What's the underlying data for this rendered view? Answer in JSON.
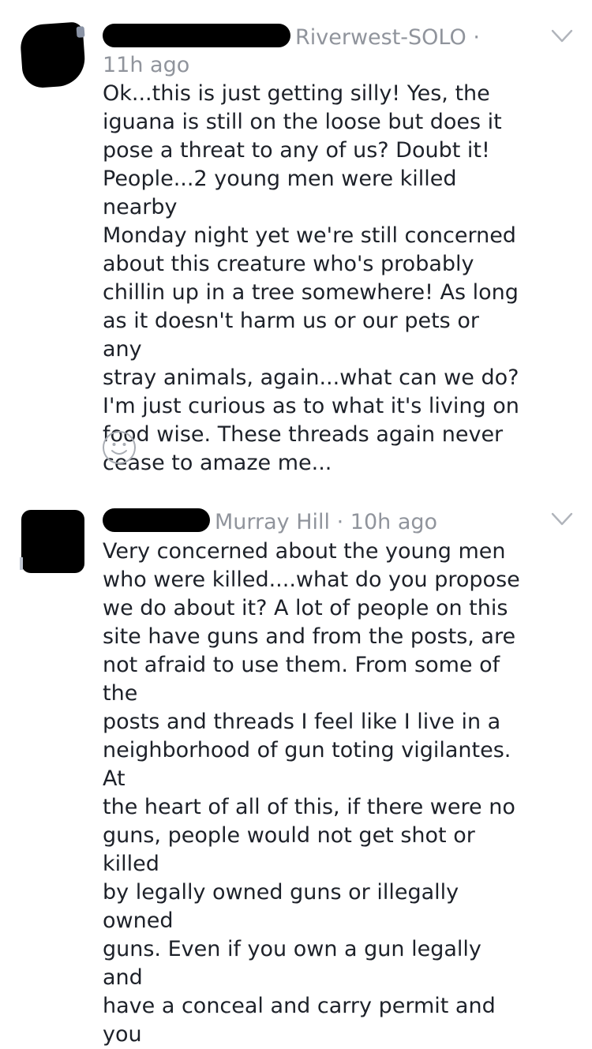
{
  "comments": [
    {
      "group": "Riverwest-SOLO ·",
      "time": "11h ago",
      "text": "Ok...this is just getting silly! Yes, the\niguana is still on the loose but does it\npose a threat to any of us? Doubt it!\nPeople...2 young men were killed nearby\nMonday night yet we're still concerned\nabout this creature who's probably\nchillin up in a tree somewhere! As long\nas it doesn't harm us or our pets or any\nstray animals, again...what can we do?\nI'm just curious as to what it's living on\nfood wise. These threads again never\ncease to amaze me...",
      "icons": {
        "menu": "chevron-down-icon",
        "reaction": "smiley-face-icon"
      }
    },
    {
      "group_and_time": "Murray Hill · 10h ago",
      "text": "Very concerned about the young men\nwho were killed....what do you propose\nwe do about it? A lot of people on this\nsite have guns and from the posts, are\nnot afraid to use them. From some of the\nposts and threads I feel like I live in a\nneighborhood of gun toting vigilantes. At\nthe heart of all of this, if there were no\nguns, people would not get shot or killed\nby legally owned guns or illegally owned\nguns. Even if you own a gun legally and\nhave a conceal and carry permit and you",
      "icons": {
        "menu": "chevron-down-icon"
      }
    }
  ],
  "colors": {
    "text": "#1d2129",
    "meta": "#90949c",
    "icon": "#b0b4bb",
    "redaction": "#000000"
  }
}
